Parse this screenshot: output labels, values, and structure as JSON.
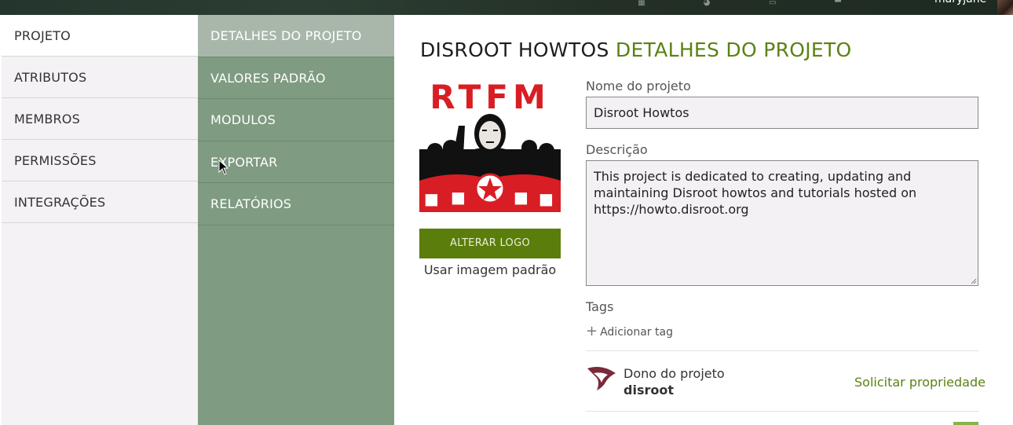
{
  "topbar": {
    "username": "maryjane",
    "icons": [
      "grid-icon",
      "globe-icon",
      "box-icon",
      "monitor-icon"
    ]
  },
  "nav": {
    "items": [
      {
        "label": "PROJETO",
        "active": true
      },
      {
        "label": "ATRIBUTOS",
        "active": false
      },
      {
        "label": "MEMBROS",
        "active": false
      },
      {
        "label": "PERMISSÕES",
        "active": false
      },
      {
        "label": "INTEGRAÇÕES",
        "active": false
      }
    ]
  },
  "subnav": {
    "items": [
      {
        "label": "DETALHES DO PROJETO",
        "active": true
      },
      {
        "label": "VALORES PADRÃO",
        "active": false
      },
      {
        "label": "MODULOS",
        "active": false
      },
      {
        "label": "EXPORTAR",
        "active": false
      },
      {
        "label": "RELATÓRIOS",
        "active": false
      }
    ]
  },
  "main": {
    "title_project": "DISROOT HOWTOS",
    "title_section": "DETALHES DO PROJETO",
    "logo_text": "RTFM",
    "change_logo_label": "ALTERAR LOGO",
    "default_image_label": "Usar imagem padrão",
    "name_label": "Nome do projeto",
    "name_value": "Disroot Howtos",
    "description_label": "Descrição",
    "description_value": "This project is dedicated to creating, updating and maintaining Disroot howtos and tutorials hosted on https://howto.disroot.org",
    "tags_label": "Tags",
    "add_tag_label": "Adicionar tag",
    "owner_label": "Dono do projeto",
    "owner_name": "disroot",
    "claim_ownership_label": "Solicitar propriedade"
  },
  "colors": {
    "accent": "#5b8213",
    "button": "#5b7d0b",
    "subnav_bg": "#7f9b82",
    "subnav_active": "#a8b7aa",
    "nav_bg": "#f4f2f5"
  }
}
